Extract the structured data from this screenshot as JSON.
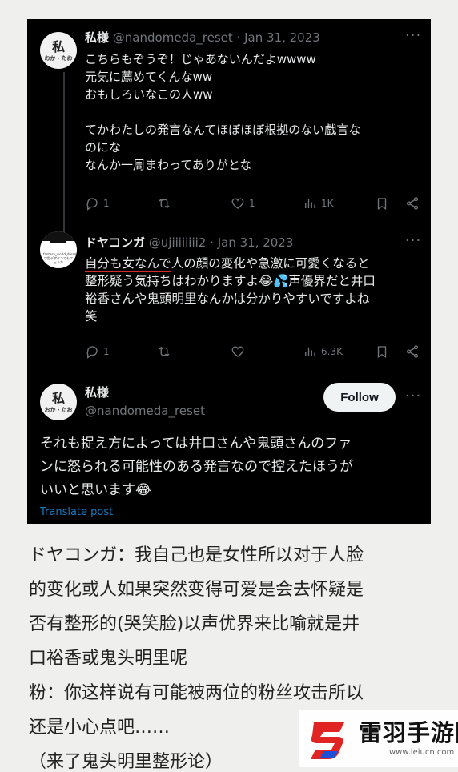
{
  "tweets": [
    {
      "avatar_glyph": "私",
      "avatar_sub": "おか・たお",
      "name": "私様",
      "handle": "@nandomeda_reset",
      "sep": "·",
      "date": "Jan 31, 2023",
      "lines": [
        "こちらもぞうぞ！じゃあないんだよwwww",
        "元気に薦めてくんなww",
        "おもしろいなこの人ww",
        "",
        "てかわたしの発言なんてほぼほぼ根拠のない戯言な",
        "のにな",
        "なんか一周まわってありがとな"
      ],
      "replies": "1",
      "retweets": "",
      "likes": "1",
      "views": "1K"
    },
    {
      "avatar_tiny": "fantasy_world_dream ワ型デザインでもフェルカ",
      "name": "ドヤコンガ",
      "handle": "@ujiiiiiiii2",
      "sep": "·",
      "date": "Jan 31, 2023",
      "line1_underlined": "自分も女なんで",
      "line1_rest": "人の顔の変化や急激に可愛くなると",
      "lines": [
        "整形疑う気持ちはわかりますよ😂💦声優界だと井口",
        "裕香さんや鬼頭明里なんかは分かりやすいですよね",
        "笑"
      ],
      "replies": "1",
      "retweets": "",
      "likes": "",
      "views": "6.3K"
    }
  ],
  "main_tweet": {
    "avatar_glyph": "私",
    "avatar_sub": "おか・たお",
    "name": "私様",
    "handle": "@nandomeda_reset",
    "follow_label": "Follow",
    "lines": [
      "それも捉え方によっては井口さんや鬼頭さんのファ",
      "ンに怒られる可能性のある発言なので控えたほうが",
      "いいと思います😂"
    ],
    "translate": "Translate post"
  },
  "more_glyph": "···",
  "caption": [
    "ドヤコンガ：我自己也是女性所以对于人脸",
    "的变化或人如果突然变得可爱是会去怀疑是",
    "否有整形的(哭笑脸)以声优界来比喻就是井",
    "口裕香或鬼头明里呢",
    "粉：你这样说有可能被两位的粉丝攻击所以",
    "还是小心点吧……",
    "（来了鬼头明里整形论）"
  ],
  "watermark": {
    "title": "雷羽手游网",
    "url": "www.leiucn.com",
    "colors": {
      "red": "#e02424",
      "blue": "#1e4fd8"
    }
  },
  "colors": {
    "background": "#000000",
    "text": "#e7e9ea",
    "muted": "#71767b",
    "link": "#1d9bf0",
    "underline": "#d42b2b"
  }
}
